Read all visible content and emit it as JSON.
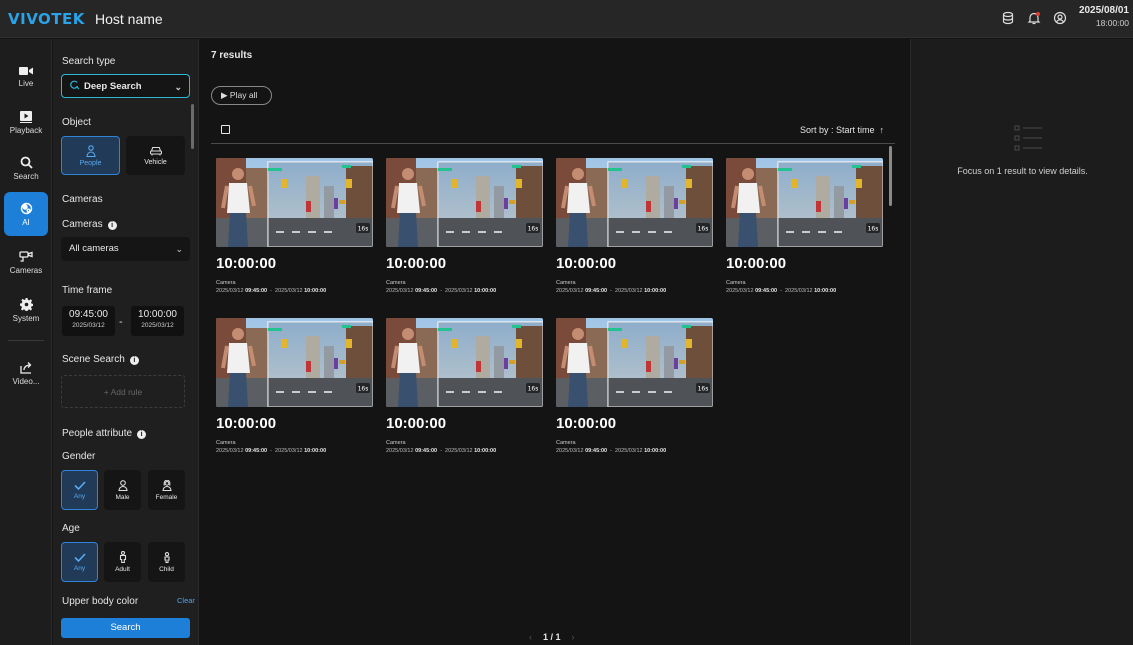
{
  "header": {
    "brand": "VIVOTEK",
    "host_name": "Host name",
    "date": "2025/08/01",
    "time": "18:00:00"
  },
  "nav": {
    "items": [
      {
        "label": "Live",
        "icon": "camera-icon"
      },
      {
        "label": "Playback",
        "icon": "play-icon"
      },
      {
        "label": "Search",
        "icon": "search-icon"
      },
      {
        "label": "AI",
        "icon": "ai-icon",
        "active": true
      },
      {
        "label": "Cameras",
        "icon": "cameras-icon"
      },
      {
        "label": "System",
        "icon": "gear-icon"
      },
      {
        "label": "Video...",
        "icon": "export-icon"
      }
    ]
  },
  "search_panel": {
    "search_type_label": "Search type",
    "search_type_value": "Deep Search",
    "object_label": "Object",
    "objects": [
      {
        "label": "People",
        "selected": true
      },
      {
        "label": "Vehicle",
        "selected": false
      }
    ],
    "cameras_heading": "Cameras",
    "cameras_label": "Cameras",
    "cameras_value": "All cameras",
    "time_frame_label": "Time frame",
    "time_from": {
      "time": "09:45:00",
      "date": "2025/03/12"
    },
    "time_to": {
      "time": "10:00:00",
      "date": "2025/03/12"
    },
    "time_separator": "-",
    "scene_search_label": "Scene Search",
    "add_rule": "+ Add rule",
    "people_attribute_label": "People attribute",
    "gender_label": "Gender",
    "gender_options": [
      {
        "label": "Any",
        "selected": true
      },
      {
        "label": "Male"
      },
      {
        "label": "Female"
      }
    ],
    "age_label": "Age",
    "age_options": [
      {
        "label": "Any",
        "selected": true
      },
      {
        "label": "Adult"
      },
      {
        "label": "Child"
      }
    ],
    "upper_body_color_label": "Upper body color",
    "clear_label": "Clear",
    "search_button": "Search"
  },
  "results": {
    "count": "7 results",
    "play_all": "Play all",
    "sort_by": "Sort by : Start time",
    "cards": [
      {
        "time": "10:00:00",
        "camera": "Camera",
        "date_from": "2025/03/12",
        "time_from": "09:45:00",
        "date_to": "2025/03/12",
        "time_to": "10:00:00",
        "duration": "16s"
      },
      {
        "time": "10:00:00",
        "camera": "Camera",
        "date_from": "2025/03/12",
        "time_from": "09:45:00",
        "date_to": "2025/03/12",
        "time_to": "10:00:00",
        "duration": "16s"
      },
      {
        "time": "10:00:00",
        "camera": "Camera",
        "date_from": "2025/03/12",
        "time_from": "09:45:00",
        "date_to": "2025/03/12",
        "time_to": "10:00:00",
        "duration": "16s"
      },
      {
        "time": "10:00:00",
        "camera": "Camera",
        "date_from": "2025/03/12",
        "time_from": "09:45:00",
        "date_to": "2025/03/12",
        "time_to": "10:00:00",
        "duration": "16s"
      },
      {
        "time": "10:00:00",
        "camera": "Camera",
        "date_from": "2025/03/12",
        "time_from": "09:45:00",
        "date_to": "2025/03/12",
        "time_to": "10:00:00",
        "duration": "16s"
      },
      {
        "time": "10:00:00",
        "camera": "Camera",
        "date_from": "2025/03/12",
        "time_from": "09:45:00",
        "date_to": "2025/03/12",
        "time_to": "10:00:00",
        "duration": "16s"
      },
      {
        "time": "10:00:00",
        "camera": "Camera",
        "date_from": "2025/03/12",
        "time_from": "09:45:00",
        "date_to": "2025/03/12",
        "time_to": "10:00:00",
        "duration": "16s"
      }
    ],
    "pagination": "1 / 1"
  },
  "details": {
    "empty_text": "Focus on 1 result to view details."
  },
  "colors": {
    "accent": "#1e7fd8",
    "brand": "#2aa3e8",
    "highlight": "#2fb7d6",
    "background": "#141414"
  }
}
